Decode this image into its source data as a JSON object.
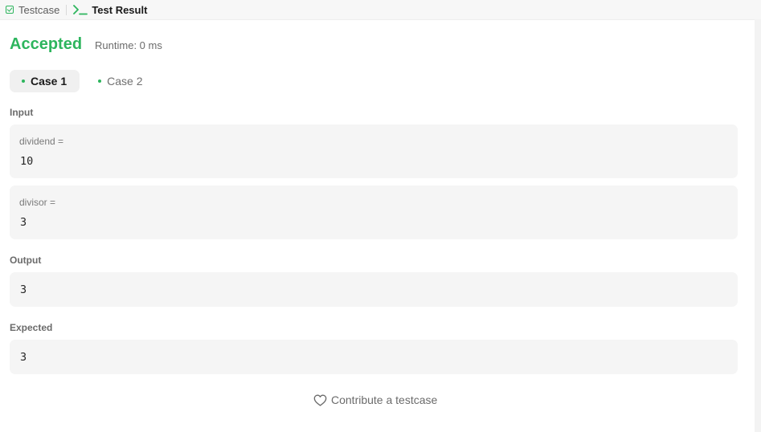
{
  "tabs": [
    {
      "label": "Testcase",
      "icon": "checkbox-icon",
      "active": false
    },
    {
      "label": "Test Result",
      "icon": "terminal-icon",
      "active": true
    }
  ],
  "result": {
    "status": "Accepted",
    "runtime": "Runtime: 0 ms"
  },
  "cases": [
    {
      "label": "Case 1",
      "active": true
    },
    {
      "label": "Case 2",
      "active": false
    }
  ],
  "input": {
    "section_label": "Input",
    "params": [
      {
        "name": "dividend =",
        "value": "10"
      },
      {
        "name": "divisor =",
        "value": "3"
      }
    ]
  },
  "output": {
    "section_label": "Output",
    "value": "3"
  },
  "expected": {
    "section_label": "Expected",
    "value": "3"
  },
  "contribute": {
    "label": "Contribute a testcase",
    "icon": "heart-icon"
  },
  "colors": {
    "accent_green": "#2db55d",
    "box_background": "#f5f5f5"
  }
}
